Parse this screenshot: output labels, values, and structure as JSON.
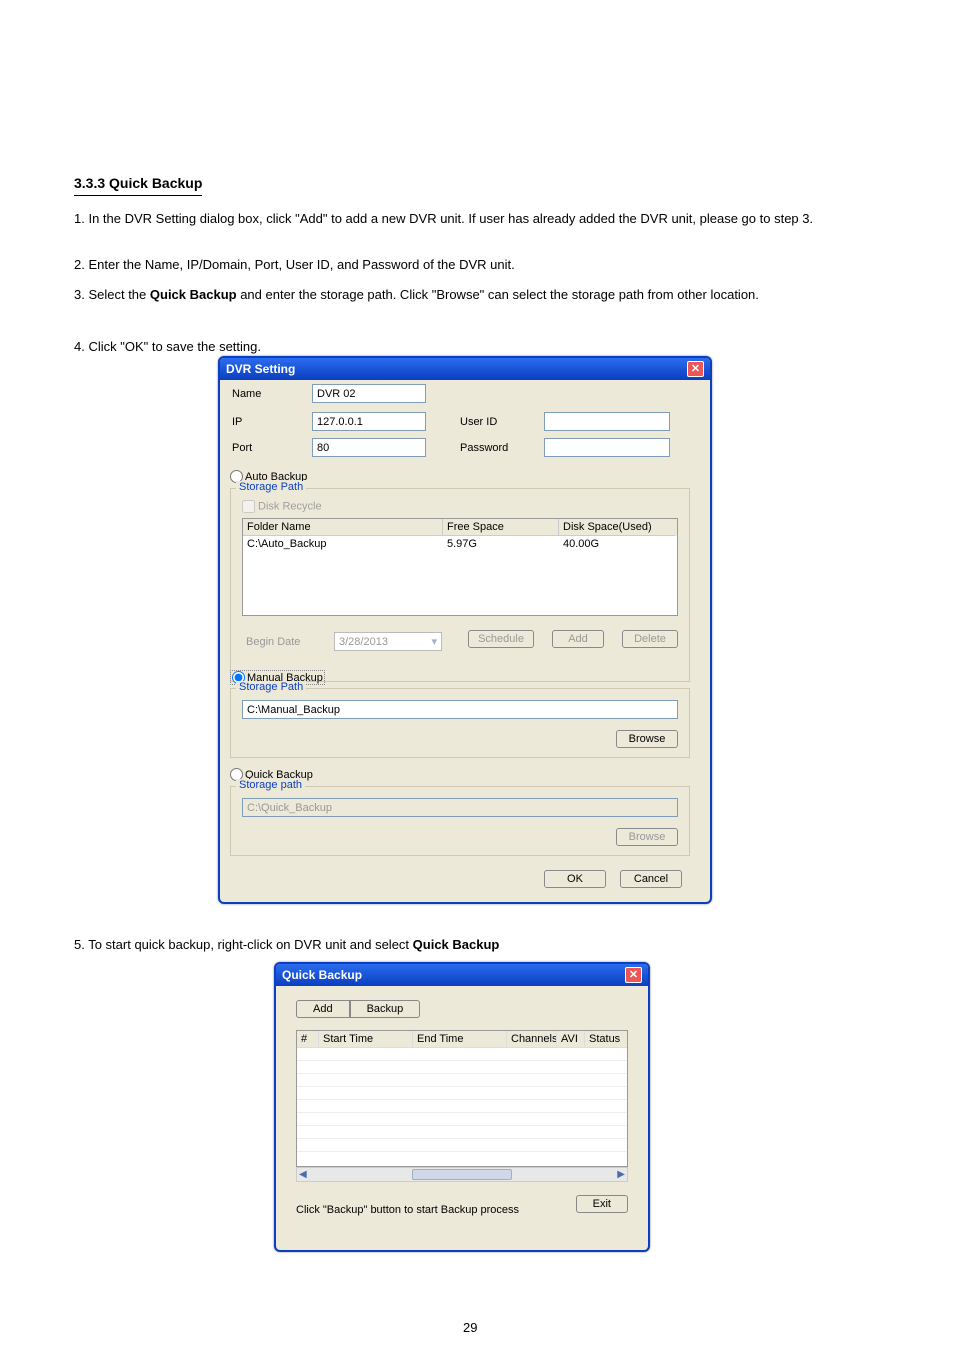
{
  "document": {
    "section_title": "3.3.3 Quick Backup",
    "paragraph1": "1. In the DVR Setting dialog box, click \"Add\" to add a new DVR unit. If user has already added the DVR unit, please go to step 3.",
    "paragraph2": "2. Enter the Name, IP/Domain, Port, User ID, and Password of the DVR unit.",
    "paragraph3_pre": "3. Select the ",
    "paragraph3_bold": "Quick Backup",
    "paragraph3_post": " and enter the storage path. Click \"Browse\" can select the storage path from other location.",
    "paragraph4": "4. Click \"OK\" to save the setting.",
    "paragraph5_pre": "5. To start quick backup, right-click on DVR unit and select ",
    "paragraph5_bold": "Quick Backup",
    "pagenum": "29"
  },
  "dvr": {
    "title": "DVR Setting",
    "labels": {
      "name": "Name",
      "ip": "IP",
      "port": "Port",
      "userid": "User ID",
      "password": "Password",
      "begin_date": "Begin Date",
      "disk_recycle": "Disk Recycle"
    },
    "values": {
      "name": "DVR 02",
      "ip": "127.0.0.1",
      "port": "80",
      "begin_date": "3/28/2013"
    },
    "radios": {
      "auto": "Auto Backup",
      "manual": "Manual Backup",
      "quick": "Quick Backup"
    },
    "fieldset_labels": {
      "auto": "Storage Path",
      "manual": "Storage Path",
      "quick": "Storage path"
    },
    "auto_table": {
      "headers": {
        "folder": "Folder Name",
        "free": "Free Space",
        "used": "Disk Space(Used)"
      },
      "row": {
        "folder": "C:\\Auto_Backup",
        "free": "5.97G",
        "used": "40.00G"
      }
    },
    "manual_path": "C:\\Manual_Backup",
    "quick_path": "C:\\Quick_Backup",
    "buttons": {
      "schedule": "Schedule",
      "add": "Add",
      "delete": "Delete",
      "browse": "Browse",
      "ok": "OK",
      "cancel": "Cancel"
    }
  },
  "quick": {
    "title": "Quick Backup",
    "buttons": {
      "add": "Add",
      "backup": "Backup",
      "exit": "Exit"
    },
    "headers": {
      "num": "#",
      "start": "Start Time",
      "end": "End Time",
      "channels": "Channels",
      "avi": "AVI",
      "status": "Status"
    },
    "hint": "Click \"Backup\" button to start Backup process"
  }
}
